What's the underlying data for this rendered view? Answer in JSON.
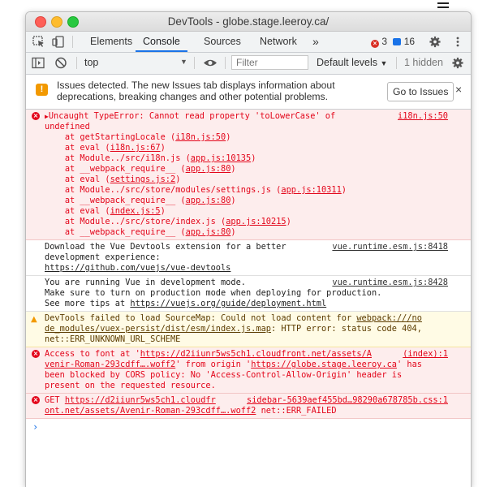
{
  "window": {
    "title": "DevTools - globe.stage.leeroy.ca/"
  },
  "tabs": [
    {
      "label": "Elements"
    },
    {
      "label": "Console",
      "active": true
    },
    {
      "label": "Sources"
    },
    {
      "label": "Network"
    }
  ],
  "tabbar": {
    "more": "»",
    "errors": "3",
    "messages": "16"
  },
  "toolbar": {
    "context": "top",
    "filter_placeholder": "Filter",
    "levels": "Default levels",
    "hidden": "1 hidden"
  },
  "banner": {
    "text": "Issues detected. The new Issues tab displays information about deprecations, breaking changes and other potential problems.",
    "button": "Go to Issues",
    "close": "×"
  },
  "console": {
    "e1": {
      "head": "Uncaught TypeError: Cannot read property 'toLowerCase' of",
      "src": "i18n.js:50",
      "line2": "undefined",
      "stack": [
        {
          "fn": "at getStartingLocale (",
          "link": "i18n.js:50",
          "end": ")"
        },
        {
          "fn": "at eval (",
          "link": "i18n.js:67",
          "end": ")"
        },
        {
          "fn": "at Module../src/i18n.js (",
          "link": "app.js:10135",
          "end": ")"
        },
        {
          "fn": "at __webpack_require__ (",
          "link": "app.js:80",
          "end": ")"
        },
        {
          "fn": "at eval (",
          "link": "settings.js:2",
          "end": ")"
        },
        {
          "fn": "at Module../src/store/modules/settings.js (",
          "link": "app.js:10311",
          "end": ")"
        },
        {
          "fn": "at __webpack_require__ (",
          "link": "app.js:80",
          "end": ")"
        },
        {
          "fn": "at eval (",
          "link": "index.js:5",
          "end": ")"
        },
        {
          "fn": "at Module../src/store/index.js (",
          "link": "app.js:10215",
          "end": ")"
        },
        {
          "fn": "at __webpack_require__ (",
          "link": "app.js:80",
          "end": ")"
        }
      ]
    },
    "l1": {
      "line1": "Download the Vue Devtools extension for a better",
      "line2": "development experience:",
      "link": "https://github.com/vuejs/vue-devtools",
      "src": "vue.runtime.esm.js:8418"
    },
    "l2": {
      "line1": "You are running Vue in development mode.",
      "line2": "Make sure to turn on production mode when deploying for production.",
      "pre": "See more tips at ",
      "link": "https://vuejs.org/guide/deployment.html",
      "src": "vue.runtime.esm.js:8428"
    },
    "w1": {
      "pre": "DevTools failed to load SourceMap: Could not load content for ",
      "link1": "webpack:///no",
      "link2": "de_modules/vuex-persist/dist/esm/index.js.map",
      "post2": ": HTTP error: status code 404,",
      "line3": "net::ERR_UNKNOWN_URL_SCHEME"
    },
    "e2": {
      "pre": "Access to font at '",
      "link1": "https://d2iiunr5ws5ch1.cloudfront.net/assets/A",
      "src": "(index):1",
      "link1b": "venir-Roman-293cdff….woff2",
      "mid": "' from origin '",
      "link2": "https://globe.stage.leeroy.ca",
      "post": "' has",
      "line3": "been blocked by CORS policy: No 'Access-Control-Allow-Origin' header is",
      "line4": "present on the requested resource."
    },
    "e3": {
      "pre": "GET ",
      "link1": "https://d2iiunr5ws5ch1.cloudfr",
      "src": "sidebar-5639aef455bd…98290a678785b.css:1",
      "link1b": "ont.net/assets/Avenir-Roman-293cdff….woff2",
      "post": " net::ERR_FAILED"
    },
    "prompt": "›"
  }
}
